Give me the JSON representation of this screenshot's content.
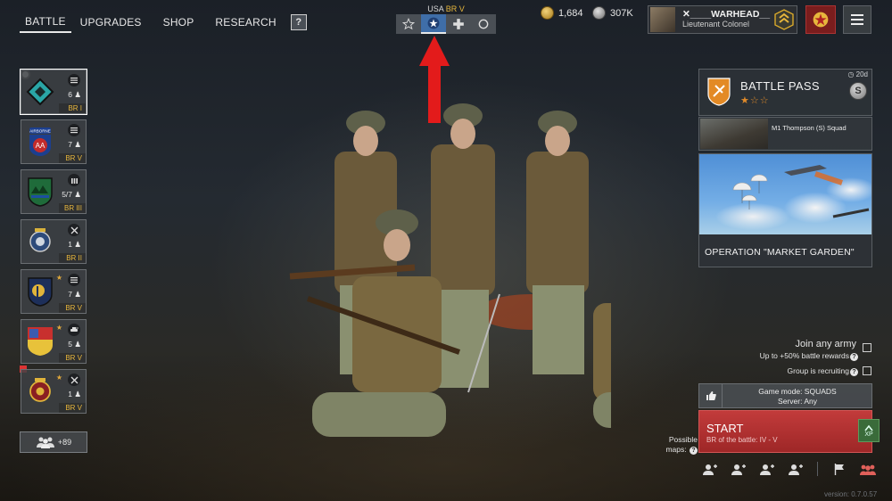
{
  "topnav": {
    "items": [
      "BATTLE",
      "UPGRADES",
      "SHOP",
      "RESEARCH"
    ],
    "help_label": "?"
  },
  "army": {
    "nation": "USA",
    "br": "BR V",
    "tabs": [
      "star-outline-icon",
      "star-filled-icon",
      "cross-icon",
      "circle-icon"
    ],
    "active_tab_index": 1
  },
  "currency": {
    "gold": "1,684",
    "silver": "307K",
    "gold_color": "#c9a13a",
    "silver_color": "#9a9a9a"
  },
  "profile": {
    "name": "✕____WARHEAD__",
    "rank": "Lieutenant Colonel"
  },
  "squads": [
    {
      "count": "6",
      "br": "BR I",
      "class_icon": "list-icon",
      "medal": ""
    },
    {
      "count": "7",
      "br": "BR V",
      "class_icon": "list-icon",
      "medal": ""
    },
    {
      "count": "5/7",
      "br": "BR III",
      "class_icon": "ammo-icon",
      "medal": ""
    },
    {
      "count": "1",
      "br": "BR II",
      "class_icon": "crossed-tools-icon",
      "medal": ""
    },
    {
      "count": "7",
      "br": "BR V",
      "class_icon": "list-icon",
      "medal": "★"
    },
    {
      "count": "5",
      "br": "BR V",
      "class_icon": "tank-icon",
      "medal": "★"
    },
    {
      "count": "1",
      "br": "BR V",
      "class_icon": "crossed-tools-icon",
      "medal": "★"
    }
  ],
  "reserve": {
    "label": "+89"
  },
  "battle_pass": {
    "title": "BATTLE PASS",
    "stars": "★☆☆",
    "days_left": "20d",
    "coin_letter": "S"
  },
  "reward": {
    "name": "M1 Thompson (S) Squad"
  },
  "event": {
    "title": "OPERATION \"MARKET GARDEN\""
  },
  "options": {
    "join_any_army": "Join any army",
    "join_any_army_sub": "Up to +50% battle rewards",
    "group_recruiting": "Group is recruiting"
  },
  "mode": {
    "game_mode": "Game mode: SQUADS",
    "server": "Server: Any"
  },
  "start": {
    "label": "START",
    "sub": "BR of the battle: IV - V"
  },
  "xp_label": "XP",
  "possible_maps": "Possible maps:",
  "version": "version: 0.7.0.57",
  "colors": {
    "accent_red": "#c23b3b",
    "br_gold": "#e7b63c",
    "active_tab_blue": "#3f6ea8"
  }
}
